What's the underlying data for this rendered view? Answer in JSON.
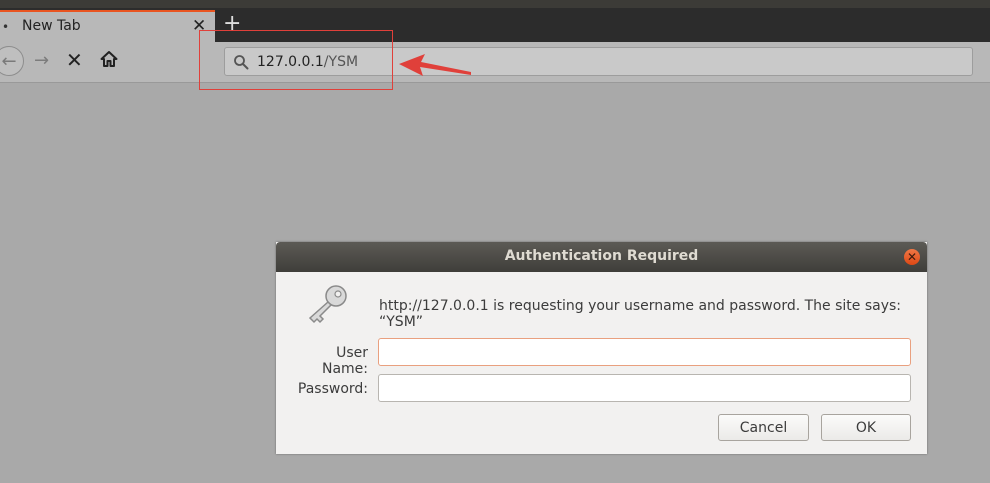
{
  "browser": {
    "tab": {
      "dot": "•",
      "title": "New Tab",
      "close": "✕"
    },
    "new_tab": "+",
    "nav": {
      "back": "←",
      "forward": "→",
      "stop": "✕"
    },
    "urlbar": {
      "host": "127.0.0.1",
      "path": "/YSM"
    }
  },
  "dialog": {
    "title": "Authentication Required",
    "close": "✕",
    "message": "http://127.0.0.1 is requesting your username and password. The site says: “YSM”",
    "username_label": "User Name:",
    "username_value": "",
    "password_label": "Password:",
    "password_value": "",
    "cancel_label": "Cancel",
    "ok_label": "OK"
  },
  "colors": {
    "accent": "#e95420",
    "annotation": "#e0403a",
    "background": "#a9a9a9"
  },
  "icons": [
    "back-arrow-icon",
    "forward-arrow-icon",
    "stop-icon",
    "home-icon",
    "search-icon",
    "key-icon",
    "close-icon",
    "annotation-arrow"
  ]
}
